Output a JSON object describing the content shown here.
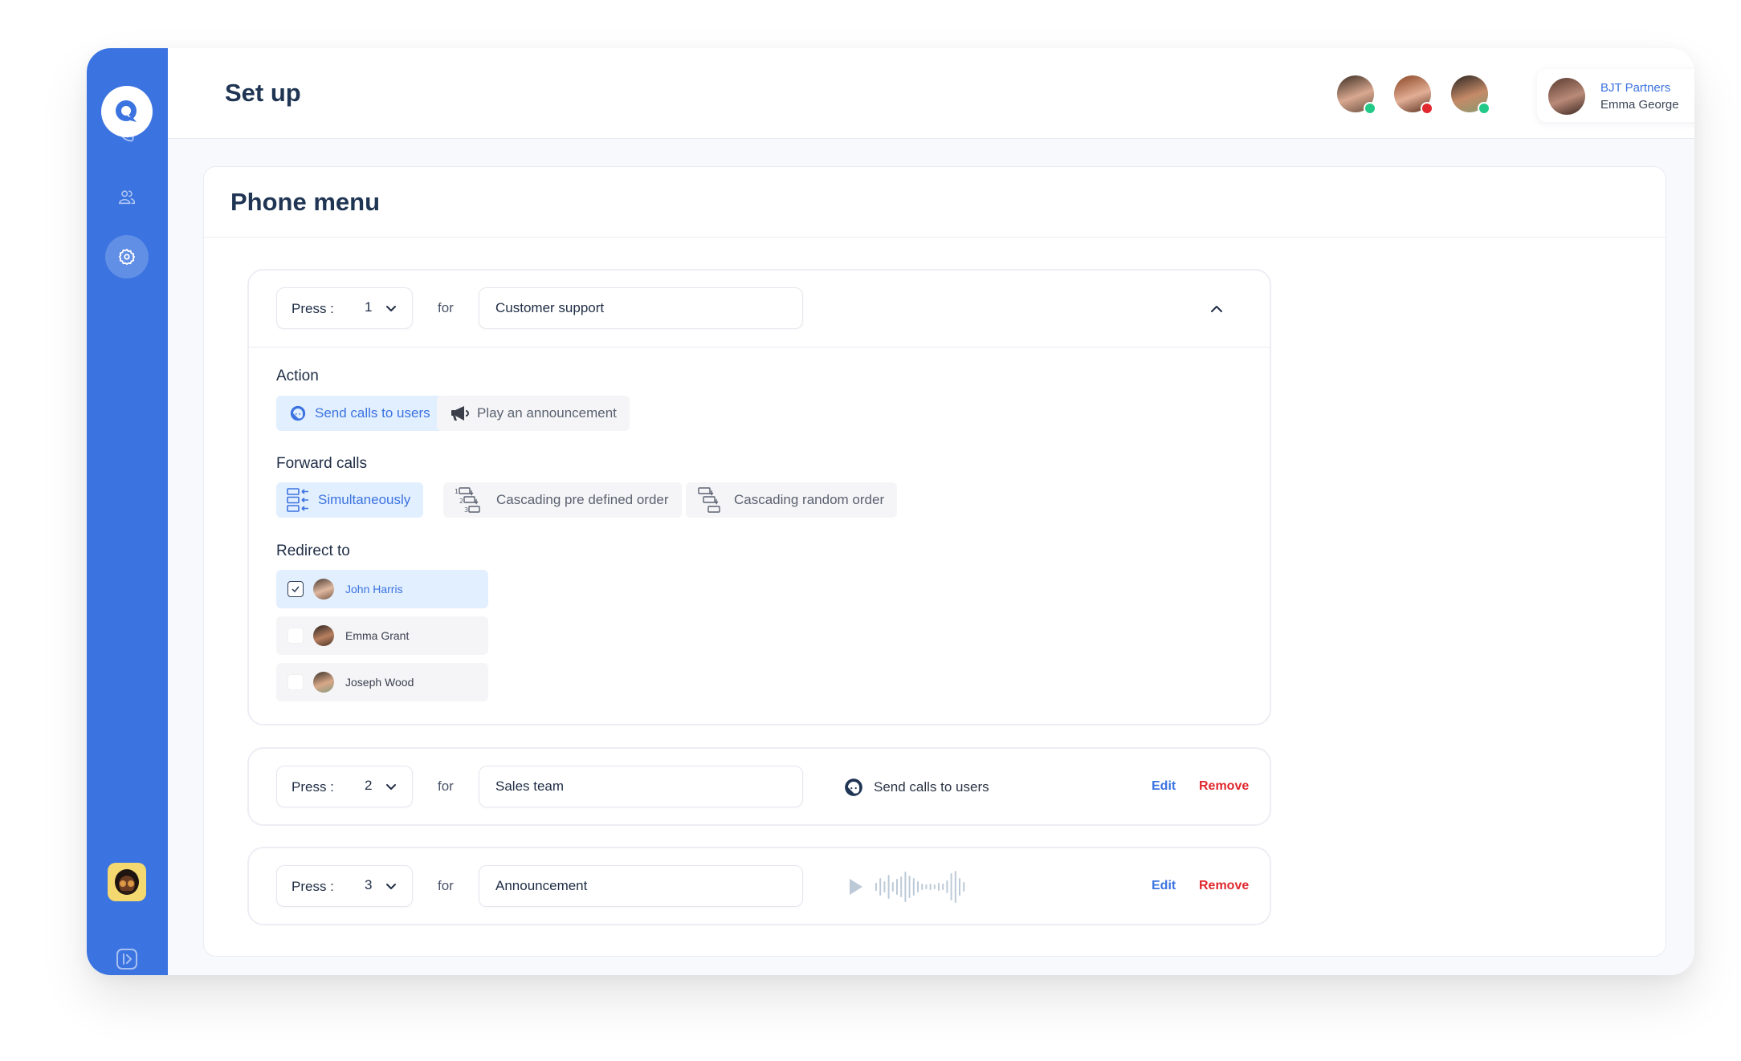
{
  "header": {
    "title": "Set up",
    "presence": [
      {
        "name": "team-member-1",
        "status": "online",
        "status_color": "#22c987"
      },
      {
        "name": "team-member-2",
        "status": "busy",
        "status_color": "#e0282e"
      },
      {
        "name": "team-member-3",
        "status": "online",
        "status_color": "#22c987"
      }
    ],
    "account": {
      "org": "BJT Partners",
      "user": "Emma George"
    }
  },
  "sidebar": {
    "items": [
      {
        "name": "calls",
        "icon": "phone-icon"
      },
      {
        "name": "contacts",
        "icon": "users-icon"
      },
      {
        "name": "settings",
        "icon": "gear-icon",
        "active": true
      }
    ],
    "expand_icon": "expand-sidebar-icon"
  },
  "panel": {
    "title": "Phone menu",
    "entries": [
      {
        "press_label": "Press :",
        "key": "1",
        "for_label": "for",
        "name": "Customer support",
        "expanded": true,
        "action_label": "Action",
        "actions": [
          {
            "label": "Send calls to users",
            "selected": true
          },
          {
            "label": "Play an announcement",
            "selected": false
          }
        ],
        "forward_label": "Forward calls",
        "forward_options": [
          {
            "label": "Simultaneously",
            "selected": true
          },
          {
            "label": "Cascading pre defined order",
            "selected": false
          },
          {
            "label": "Cascading random order",
            "selected": false
          }
        ],
        "redirect_label": "Redirect to",
        "users": [
          {
            "name": "John Harris",
            "checked": true
          },
          {
            "name": "Emma Grant",
            "checked": false
          },
          {
            "name": "Joseph Wood",
            "checked": false
          }
        ]
      },
      {
        "press_label": "Press :",
        "key": "2",
        "for_label": "for",
        "name": "Sales team",
        "summary": "Send calls to users",
        "edit": "Edit",
        "remove": "Remove"
      },
      {
        "press_label": "Press :",
        "key": "3",
        "for_label": "for",
        "name": "Announcement",
        "summary_type": "audio",
        "edit": "Edit",
        "remove": "Remove"
      }
    ]
  },
  "colors": {
    "accent": "#3b73e0",
    "danger": "#e0282e",
    "online": "#22c987",
    "selected_bg": "#e2efff"
  }
}
